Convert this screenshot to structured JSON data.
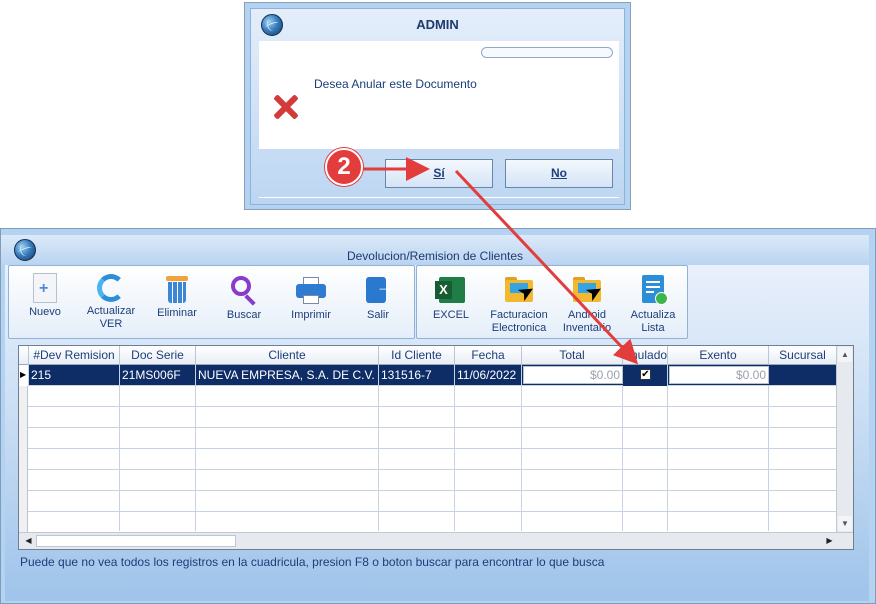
{
  "dialog": {
    "title": "ADMIN",
    "message": "Desea Anular este Documento",
    "yes_label": "Sí",
    "no_label": "No"
  },
  "annotation": {
    "step": "2",
    "color": "#e23c3c"
  },
  "window": {
    "title": "Devolucion/Remision de Clientes"
  },
  "toolbar": {
    "nuevo": "Nuevo",
    "actualizar_1": "Actualizar",
    "actualizar_2": "VER",
    "eliminar": "Eliminar",
    "buscar": "Buscar",
    "imprimir": "Imprimir",
    "salir": "Salir",
    "excel": "EXCEL",
    "facturacion_1": "Facturacion",
    "facturacion_2": "Electronica",
    "android_1": "Android",
    "android_2": "Inventario",
    "actualiza_1": "Actualiza",
    "actualiza_2": "Lista"
  },
  "grid": {
    "columns": [
      "#Dev Remision",
      "Doc Serie",
      "Cliente",
      "Id Cliente",
      "Fecha",
      "Total",
      "Anulado",
      "Exento",
      "Sucursal"
    ],
    "rows": [
      {
        "dev_remision": "215",
        "doc_serie": "21MS006F",
        "cliente": "NUEVA EMPRESA, S.A. DE C.V.",
        "id_cliente": "131516-7",
        "fecha": "11/06/2022",
        "total": "$0.00",
        "anulado": true,
        "exento": "$0.00",
        "sucursal": ""
      }
    ]
  },
  "hint": "Puede que no vea todos los registros en la cuadricula, presion F8 o boton buscar para encontrar lo que busca",
  "colors": {
    "selected_row": "#0e2d67",
    "window_bg": "#b4d2f2",
    "text": "#1d3e7a"
  }
}
